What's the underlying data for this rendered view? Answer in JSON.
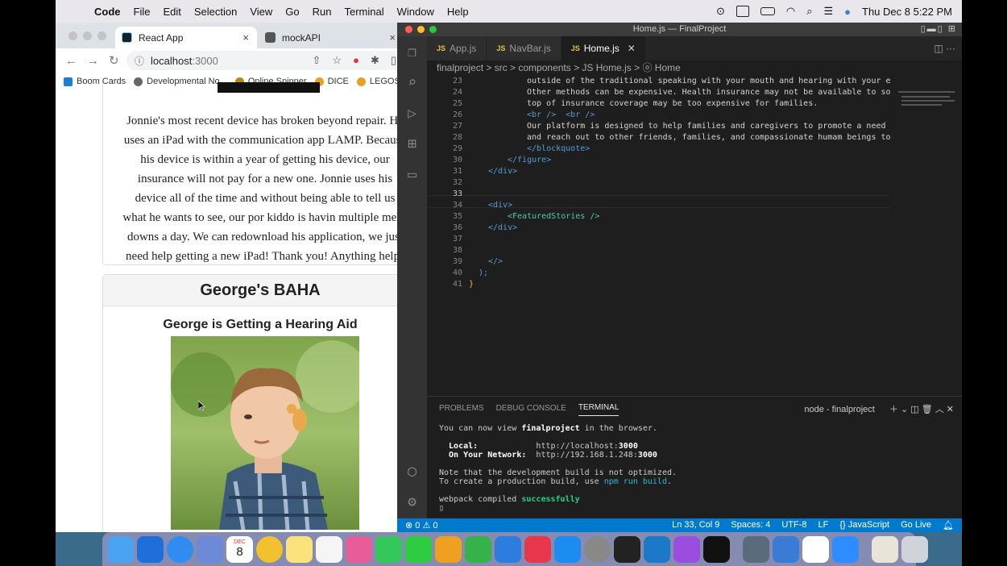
{
  "menubar": {
    "app": "Code",
    "items": [
      "File",
      "Edit",
      "Selection",
      "View",
      "Go",
      "Run",
      "Terminal",
      "Window",
      "Help"
    ],
    "clock": "Thu Dec 8  5:22 PM"
  },
  "chrome": {
    "tabs": [
      {
        "title": "React App",
        "close": "×"
      },
      {
        "title": "mockAPI",
        "close": "×"
      }
    ],
    "url_host": "localhost",
    "url_port": ":3000",
    "bookmarks": [
      "Boom Cards",
      "Developmental No...",
      "Online Spinner",
      "DICE",
      "LEGOS"
    ]
  },
  "page": {
    "story_text": "Jonnie's most recent device has broken beyond repair. He\nuses an iPad with the communication app LAMP. Because\nhis device is within a year of getting his device, our\ninsurance will not pay for a new one. Jonnie uses his\ndevice all of the time and without being able to tell us\nwhat he wants to see, our por kiddo is havin multiple melt-\ndowns a day. We can redownload his application, we just\nneed help getting a new iPad! Thank you! Anything helps",
    "card_title": "George's BAHA",
    "card_subtitle": "George is Getting a Hearing Aid"
  },
  "vscode": {
    "window_title": "Home.js — FinalProject",
    "tabs": [
      {
        "label": "App.js",
        "active": false
      },
      {
        "label": "NavBar.js",
        "active": false
      },
      {
        "label": "Home.js",
        "active": true
      }
    ],
    "breadcrumb": "finalproject > src > components > JS Home.js > ⓞ Home",
    "code_lines": [
      {
        "n": "23",
        "indent": 12,
        "html": "outside of the traditional speaking with your mouth and hearing with your ear"
      },
      {
        "n": "24",
        "indent": 12,
        "html": "Other methods can be expensive. Health insurance may not be available to some"
      },
      {
        "n": "25",
        "indent": 12,
        "html": "top of insurance coverage may be too expensive for families."
      },
      {
        "n": "26",
        "indent": 12,
        "html": "<br />  <br />"
      },
      {
        "n": "27",
        "indent": 12,
        "html": "Our platform is designed to help families and caregivers to promote a need"
      },
      {
        "n": "28",
        "indent": 12,
        "html": "and reach out to other friends, families, and compassionate humam beings to h"
      },
      {
        "n": "29",
        "indent": 12,
        "html": "</blockquote>"
      },
      {
        "n": "30",
        "indent": 8,
        "html": "</figure>"
      },
      {
        "n": "31",
        "indent": 4,
        "html": "</div>"
      },
      {
        "n": "32",
        "indent": 0,
        "html": ""
      },
      {
        "n": "33",
        "indent": 0,
        "html": ""
      },
      {
        "n": "34",
        "indent": 4,
        "html": "<div>"
      },
      {
        "n": "35",
        "indent": 8,
        "html": "<FeaturedStories />"
      },
      {
        "n": "36",
        "indent": 4,
        "html": "</div>"
      },
      {
        "n": "37",
        "indent": 0,
        "html": ""
      },
      {
        "n": "38",
        "indent": 0,
        "html": ""
      },
      {
        "n": "39",
        "indent": 4,
        "html": "</>"
      },
      {
        "n": "40",
        "indent": 2,
        "html": ");"
      },
      {
        "n": "41",
        "indent": 0,
        "html": "}"
      }
    ],
    "panel_tabs": [
      "PROBLEMS",
      "DEBUG CONSOLE",
      "TERMINAL"
    ],
    "panel_right": "node - finalproject",
    "terminal": {
      "l1a": "You can now view ",
      "l1b": "finalproject",
      "l1c": " in the browser.",
      "local_label": "  Local:            ",
      "local_url": "http://localhost:",
      "local_port": "3000",
      "net_label": "  On Your Network:  ",
      "net_url": "http://192.168.1.248:",
      "net_port": "3000",
      "note1": "Note that the development build is not optimized.",
      "note2a": "To create a production build, use ",
      "note2b": "npm run build",
      "note2c": ".",
      "wp_a": "webpack compiled ",
      "wp_b": "successfully"
    },
    "status_left": "⊗ 0 ⚠ 0",
    "status_right": [
      "Ln 33, Col 9",
      "Spaces: 4",
      "UTF-8",
      "LF",
      "{} JavaScript",
      "Go Live"
    ]
  },
  "dock": {
    "calendar_month": "DEC",
    "calendar_day": "8"
  }
}
